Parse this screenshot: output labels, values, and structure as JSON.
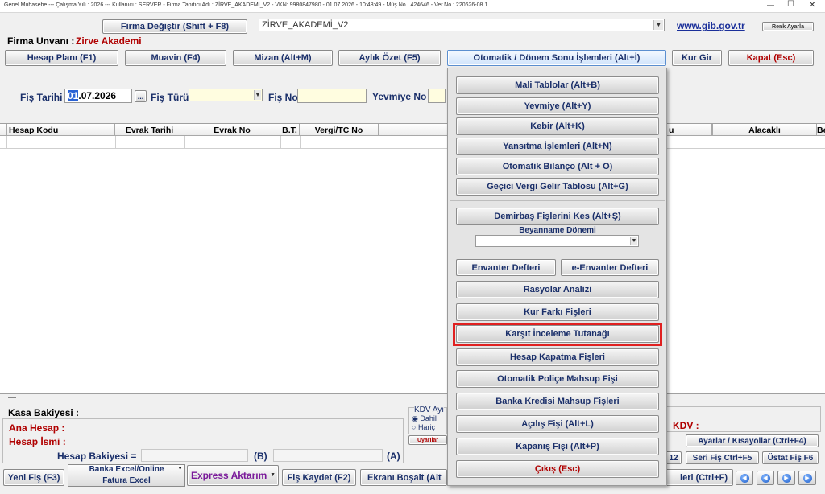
{
  "title_bar": {
    "text": "Genel Muhasebe  ---  Çalışma Yılı : 2026  ---  Kullanıcı : SERVER - Firma Tanıtıcı Adı : ZİRVE_AKADEMİ_V2 - VKN: 9980847980 - 01.07.2026 - 10:48:49 - Müş.No : 424646 - Ver.No : 220626-08.1",
    "minimize": "—",
    "maximize": "☐",
    "close": "✕"
  },
  "top": {
    "firma_degistir": "Firma Değiştir (Shift + F8)",
    "firma_select_value": "ZİRVE_AKADEMİ_V2",
    "gib_link": "www.gib.gov.tr",
    "renk_ayarla": "Renk Ayarla",
    "firma_unvani_label": "Firma Unvanı :",
    "firma_unvani_value": "Zirve Akademi"
  },
  "toolbar": {
    "hesap_plani": "Hesap Planı (F1)",
    "muavin": "Muavin (F4)",
    "mizan": "Mizan (Alt+M)",
    "aylik_ozet": "Aylık Özet (F5)",
    "otomatik": "Otomatik / Dönem Sonu İşlemleri (Alt+İ)",
    "kur_gir": "Kur Gir",
    "kapat": "Kapat (Esc)"
  },
  "form": {
    "fis_tarihi_label": "Fiş Tarihi",
    "fis_tarihi_value_sel": "01",
    "fis_tarihi_value_rest": ".07.2026",
    "date_picker": "...",
    "fis_turu_label": "Fiş Türü",
    "fis_no_label": "Fiş No",
    "yevmiye_no_label": "Yevmiye No"
  },
  "table": {
    "headers": [
      "Hesap Kodu",
      "Evrak Tarihi",
      "Evrak No",
      "B.T.",
      "Vergi/TC No",
      "u",
      "Alacaklı",
      "Be"
    ]
  },
  "menu": {
    "items": [
      "Mali Tablolar (Alt+B)",
      "Yevmiye (Alt+Y)",
      "Kebir (Alt+K)",
      "Yansıtma İşlemleri (Alt+N)",
      "Otomatik Bilanço (Alt + O)",
      "Geçici Vergi Gelir Tablosu (Alt+G)"
    ],
    "demirbas": "Demirbaş Fişlerini Kes (Alt+Ş)",
    "beyanname_label": "Beyanname Dönemi",
    "envanter": "Envanter Defteri",
    "e_envanter": "e-Envanter Defteri",
    "items2": [
      "Rasyolar Analizi",
      "Kur Farkı Fişleri",
      "Karşıt İnceleme Tutanağı",
      "Hesap Kapatma Fişleri",
      "Otomatik Poliçe Mahsup Fişi",
      "Banka Kredisi Mahsup Fişleri",
      "Açılış Fişi (Alt+L)",
      "Kapanış Fişi (Alt+P)"
    ],
    "cikis": "Çıkış (Esc)",
    "highlight_color": "#e02020"
  },
  "bottom": {
    "kasa_bakiyesi": "Kasa Bakiyesi :",
    "ana_hesap": "Ana Hesap :",
    "hesap_ismi": "Hesap İsmi :",
    "hesap_bakiyesi": "Hesap Bakiyesi =",
    "b_label": "(B)",
    "a_label": "(A)",
    "kdv_group": "KDV Ayı",
    "dahil": "Dahil",
    "haric": "Hariç",
    "uyarilar": "Uyarılar",
    "kdv_label": "KDV :",
    "ayarlar": "Ayarlar / Kısayollar (Ctrl+F4)",
    "seri_fis": "Seri Fiş Ctrl+F5",
    "ustat_fis": "Üstat Fiş F6",
    "f12_partial": "12",
    "yeni_fis": "Yeni Fiş (F3)",
    "banka_excel": "Banka Excel/Online",
    "fatura_excel": "Fatura Excel",
    "express": "Express Aktarım",
    "fis_kaydet": "Fiş Kaydet (F2)",
    "ekrani_bosalt": "Ekranı Boşalt (Alt",
    "ctrl_f_partial": "leri (Ctrl+F)"
  }
}
